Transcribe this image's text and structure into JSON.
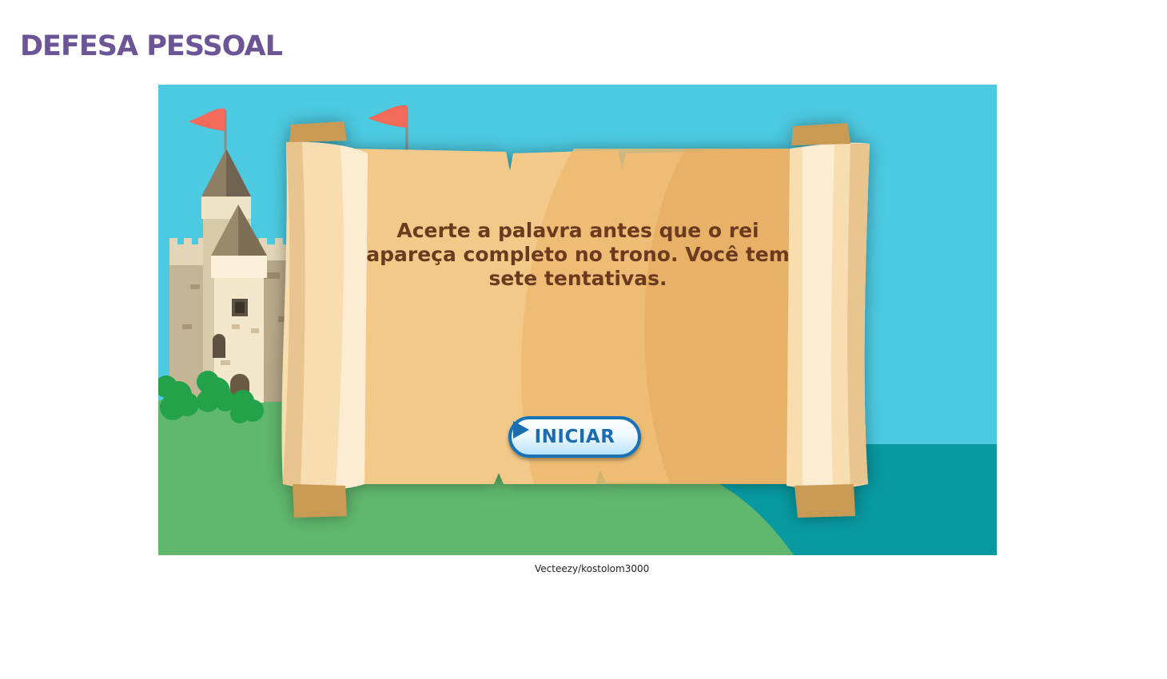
{
  "page": {
    "title": "DEFESA PESSOAL"
  },
  "game": {
    "instructions": "Acerte a palavra antes que o rei apareça completo no trono. Você tem sete tentativas.",
    "start_button": {
      "label": "INICIAR",
      "icon": "play-arrow-icon"
    },
    "colors": {
      "sky": "#4ccae1",
      "grass": "#60b76e",
      "sea": "#0899a1",
      "parchment": "#f3c98a",
      "text": "#6b3a1f",
      "button_border": "#1773b5",
      "flag": "#f26a5a"
    }
  },
  "credit": "Vecteezy/kostolom3000"
}
